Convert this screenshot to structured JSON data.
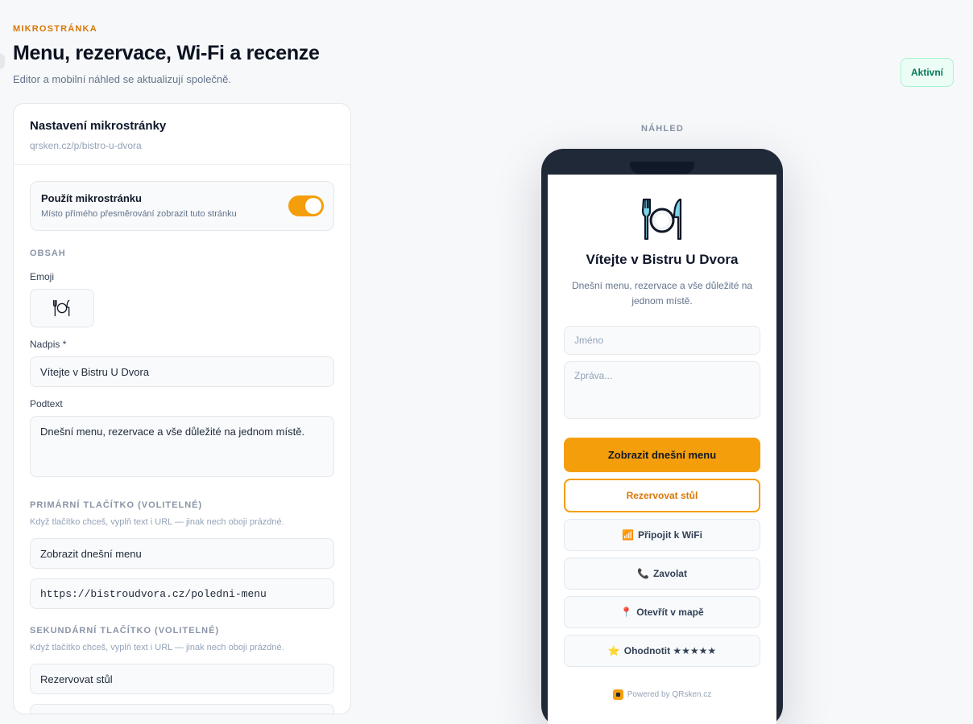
{
  "header": {
    "eyebrow": "MIKROSTRÁNKA",
    "title": "Menu, rezervace, Wi‑Fi a recenze",
    "subtitle": "Editor a mobilní náhled se aktualizují společně.",
    "status": "Aktivní"
  },
  "editor": {
    "title": "Nastavení mikrostránky",
    "url": "qrsken.cz/p/bistro-u-dvora",
    "toggle": {
      "title": "Použít mikrostránku",
      "description": "Místo přímého přesměrování zobrazit tuto stránku",
      "enabled": true
    },
    "content_section": "OBSAH",
    "emoji_label": "Emoji",
    "emoji_icon": "plate-cutlery-icon",
    "heading_label": "Nadpis *",
    "heading_value": "Vítejte v Bistru U Dvora",
    "subtext_label": "Podtext",
    "subtext_value": "Dnešní menu, rezervace a vše důležité na jednom místě.",
    "primary_section": "PRIMÁRNÍ TLAČÍTKO (VOLITELNÉ)",
    "primary_helper": "Když tlačítko chceš, vyplň text i URL — jinak nech oboji prázdné.",
    "primary_text": "Zobrazit dnešní menu",
    "primary_url": "https://bistroudvora.cz/poledni-menu",
    "secondary_section": "SEKUNDÁRNÍ TLAČÍTKO (VOLITELNÉ)",
    "secondary_helper": "Když tlačítko chceš, vyplň text i URL — jinak nech oboji prázdné.",
    "secondary_text": "Rezervovat stůl"
  },
  "preview": {
    "label": "NÁHLED",
    "title": "Vítejte v Bistru U Dvora",
    "subtitle": "Dnešní menu, rezervace a vše důležité na jednom místě.",
    "name_placeholder": "Jméno",
    "message_placeholder": "Zpráva...",
    "primary_button": "Zobrazit dnešní menu",
    "secondary_button": "Rezervovat stůl",
    "wifi_emoji": "📶",
    "wifi_button": "Připojit k WiFi",
    "call_emoji": "📞",
    "call_button": "Zavolat",
    "map_emoji": "📍",
    "map_button": "Otevřít v mapě",
    "rate_emoji": "⭐",
    "rate_button": "Ohodnotit ★★★★★",
    "powered": "Powered by QRsken.cz"
  },
  "colors": {
    "accent": "#f59e0b",
    "accent_text": "#d97706",
    "success": "#047857"
  }
}
